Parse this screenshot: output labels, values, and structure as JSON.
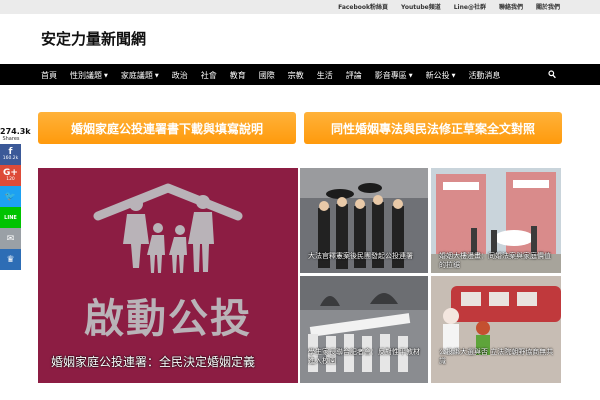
{
  "topbar": {
    "links": [
      "Facebook粉絲頁",
      "Youtube頻道",
      "Line@社群",
      "聯絡我們",
      "關於我們"
    ]
  },
  "site": {
    "title": "安定力量新聞網"
  },
  "nav": {
    "items": [
      {
        "label": "首頁",
        "dropdown": false
      },
      {
        "label": "性別議題",
        "dropdown": true
      },
      {
        "label": "家庭議題",
        "dropdown": true
      },
      {
        "label": "政治",
        "dropdown": false
      },
      {
        "label": "社會",
        "dropdown": false
      },
      {
        "label": "教育",
        "dropdown": false
      },
      {
        "label": "國際",
        "dropdown": false
      },
      {
        "label": "宗教",
        "dropdown": false
      },
      {
        "label": "生活",
        "dropdown": false
      },
      {
        "label": "評論",
        "dropdown": false
      },
      {
        "label": "影音專區",
        "dropdown": true
      },
      {
        "label": "新公投",
        "dropdown": true
      },
      {
        "label": "活動消息",
        "dropdown": false
      }
    ],
    "search_icon": "search-icon"
  },
  "cta": {
    "left": "婚姻家庭公投連署書下載與填寫說明",
    "right": "同性婚姻專法與民法修正草案全文對照"
  },
  "share": {
    "total": "274.3k",
    "label": "Shares",
    "buttons": [
      {
        "network": "facebook",
        "glyph": "f",
        "count": "160.2k",
        "color": "#3b5998"
      },
      {
        "network": "google-plus",
        "glyph": "G+",
        "count": "120",
        "color": "#dd4b39"
      },
      {
        "network": "twitter",
        "glyph": "🐦",
        "count": "",
        "color": "#1da1f2"
      },
      {
        "network": "line",
        "glyph": "LINE",
        "count": "",
        "color": "#00c300"
      },
      {
        "network": "email",
        "glyph": "✉",
        "count": "",
        "color": "#9aa0a6"
      },
      {
        "network": "sumome",
        "glyph": "♛",
        "count": "",
        "color": "#2d6db5"
      }
    ]
  },
  "articles": {
    "featured": {
      "image_lettering": "啟動公投",
      "title": "婚姻家庭公投連署：全民決定婚姻定義"
    },
    "top_middle": {
      "title": "大法官釋憲案後民團發起公投連署"
    },
    "top_right": {
      "title": "婚姻大樓漫畫：同婚法案與家庭價值的拉鋸"
    },
    "bottom_middle": {
      "title": "學生家長聯合記者會：反對性平教材進入校園"
    },
    "bottom_right": {
      "title": "公投綁大選與否 立法院朝野協商無共識"
    }
  },
  "colors": {
    "nav_bg": "#000000",
    "topbar_bg": "#ebebeb",
    "cta_orange": "#ff9f1a",
    "featured_bg": "#8c1d43"
  }
}
